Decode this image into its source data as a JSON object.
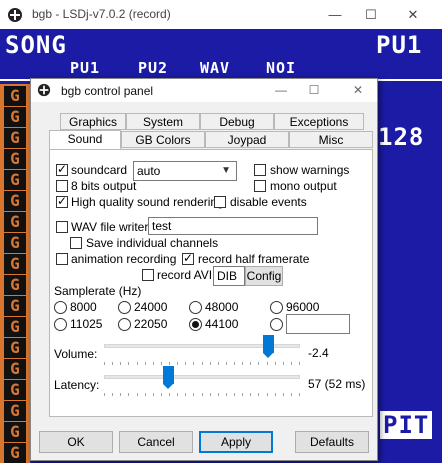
{
  "outer_window": {
    "title": "bgb - LSDj-v7.0.2 (record)",
    "minimize": "—",
    "maximize": "☐",
    "close": "✕"
  },
  "game": {
    "song": "SONG",
    "channels": [
      "PU1",
      "PU2",
      "WAV",
      "NOI"
    ],
    "right_label": "PU1",
    "number": "128",
    "pit": "PIT"
  },
  "dialog": {
    "title": "bgb control panel",
    "minimize": "—",
    "maximize": "☐",
    "close": "✕",
    "tabs_row1": [
      "Graphics",
      "System",
      "Debug",
      "Exceptions"
    ],
    "tabs_row2": [
      "Sound",
      "GB Colors",
      "Joypad",
      "Misc"
    ],
    "active_tab": "Sound",
    "soundcard": {
      "label": "soundcard",
      "checked": true,
      "value": "auto"
    },
    "show_warnings": {
      "label": "show warnings",
      "checked": false
    },
    "bits8": {
      "label": "8 bits output",
      "checked": false
    },
    "mono": {
      "label": "mono output",
      "checked": false
    },
    "hq": {
      "label": "High quality sound rendering",
      "checked": true
    },
    "disable_events": {
      "label": "disable events",
      "checked": false
    },
    "wav_writer": {
      "label": "WAV file writer",
      "checked": false,
      "value": "test"
    },
    "save_individual": {
      "label": "Save individual channels",
      "checked": false
    },
    "anim_recording": {
      "label": "animation recording",
      "checked": false
    },
    "record_half": {
      "label": "record half framerate",
      "checked": true
    },
    "record_avi": {
      "label": "record AVI",
      "checked": false,
      "codec": "DIB",
      "config": "Config"
    },
    "samplerate_label": "Samplerate (Hz)",
    "samplerates": [
      "8000",
      "24000",
      "48000",
      "96000",
      "11025",
      "22050",
      "44100"
    ],
    "samplerate_selected": "44100",
    "samplerate_custom": "",
    "volume": {
      "label": "Volume:",
      "value": "-2.4",
      "level": 0.86
    },
    "latency": {
      "label": "Latency:",
      "value": "57  (52 ms)",
      "level": 0.32
    },
    "buttons": {
      "ok": "OK",
      "cancel": "Cancel",
      "apply": "Apply",
      "defaults": "Defaults"
    }
  }
}
